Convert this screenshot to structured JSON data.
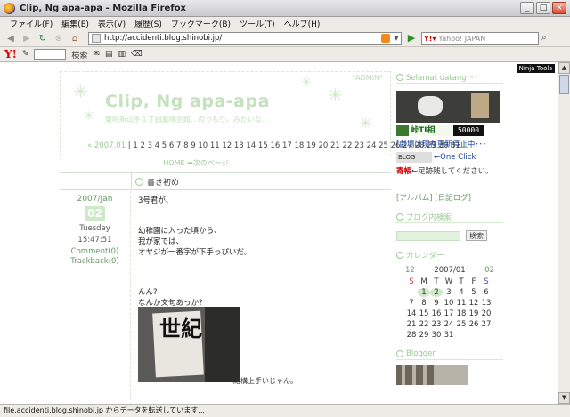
{
  "window": {
    "title": "Clip, Ng apa-apa - Mozilla Firefox"
  },
  "menu": [
    "ファイル(F)",
    "編集(E)",
    "表示(V)",
    "履歴(S)",
    "ブックマーク(B)",
    "ツール(T)",
    "ヘルプ(H)"
  ],
  "nav": {
    "url": "http://accidenti.blog.shinobi.jp/",
    "search_placeholder": "Yahoo! JAPAN"
  },
  "ytoolbar": {
    "logo": "Y!",
    "search_label": "検索"
  },
  "page": {
    "ninja_tools": "Ninja Tools",
    "admin": "*ADMIN*",
    "site_title": "Clip, Ng apa-apa",
    "site_subtitle": "東昭新山手１丁目劇場別館…のつもり。みたいな…",
    "month_label": "2007.01",
    "day_links": "1 2 3 4 5 6 7 8 9 10 11 12 13 14 15 16 17 18 19 20 21 22 23 24 25 26 27 28 29 30 31",
    "prev_arrow": "«",
    "next_arrow": "»",
    "pager": "HOME ➡次のページ",
    "entry": {
      "title": "書き初め",
      "date": "2007/Jan",
      "day": "02",
      "weekday": "Tuesday",
      "time": "15:47:51",
      "comment": "Comment(0)",
      "trackback": "Trackback(0)",
      "line1": "3号君が、",
      "line2": "幼稚園に入った頃から、",
      "line3": "我が家では、",
      "line4": "オヤジが一番字が下手っぴいだ。",
      "line5": "んん?",
      "line6": "なんか文句あっか?",
      "photo_text": "世紀",
      "caption": "結構上手いじゃん。"
    },
    "sidebar": {
      "welcome_title": "Selamat datang･･･",
      "badge_text": "峠TI相",
      "counter": "50000",
      "link1": "[劇場は現在更新停止中･･･",
      "blog_badge": "BLOG",
      "oneclick": "←One Click",
      "red_label": "寄帳",
      "red_rest": "←足跡残してください。",
      "links2": "[アルバム] [日記ログ]",
      "blogsearch_title": "ブログ内検索",
      "search_button": "検索",
      "calendar_title": "カレンダー",
      "cal_prev": "12",
      "cal_month": "2007/01",
      "cal_next": "02",
      "weekdays": [
        "S",
        "M",
        "T",
        "W",
        "T",
        "F",
        "S"
      ],
      "days": [
        "",
        "1",
        "2",
        "3",
        "4",
        "5",
        "6",
        "7",
        "8",
        "9",
        "10",
        "11",
        "12",
        "13",
        "14",
        "15",
        "16",
        "17",
        "18",
        "19",
        "20",
        "21",
        "22",
        "23",
        "24",
        "25",
        "26",
        "27",
        "28",
        "29",
        "30",
        "31",
        "",
        "",
        ""
      ],
      "blogger_title": "Blogger"
    }
  },
  "status": "file.accidenti.blog.shinobi.jp からデータを転送しています..."
}
